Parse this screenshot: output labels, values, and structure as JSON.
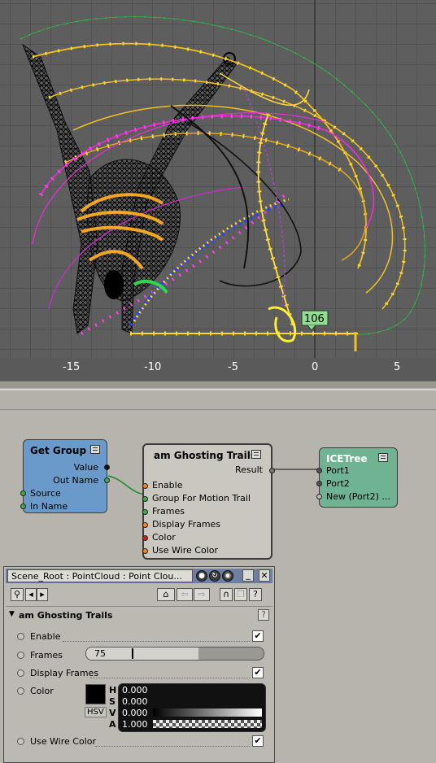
{
  "viewport": {
    "frame_label": "106",
    "ruler_ticks": [
      "-15",
      "-10",
      "-5",
      "0",
      "5"
    ]
  },
  "nodes": {
    "get_group": {
      "title": "Get Group",
      "ports": [
        "Value",
        "Out Name",
        "Source",
        "In Name"
      ],
      "color": "#6a9ac9"
    },
    "ghosting": {
      "title": "am Ghosting Trails",
      "result": "Result",
      "ports": [
        "Enable",
        "Group For Motion Trail",
        "Frames",
        "Display Frames",
        "Color",
        "Use Wire Color"
      ],
      "color": "#c9c7bf"
    },
    "icetree": {
      "title": "ICETree",
      "ports": [
        "Port1",
        "Port2",
        "New (Port2) ..."
      ],
      "color": "#6fb393"
    }
  },
  "panel": {
    "title": "Scene_Root : PointCloud : Point Clou...",
    "section": "am Ghosting Trails",
    "help": "?",
    "props": {
      "enable_label": "Enable",
      "frames_label": "Frames",
      "frames_value": "75",
      "display_frames_label": "Display Frames",
      "color_label": "Color",
      "color_mode": "HSV",
      "h_label": "H",
      "h_value": "0.000",
      "s_label": "S",
      "s_value": "0.000",
      "v_label": "V",
      "v_value": "0.000",
      "a_label": "A",
      "a_value": "1.000",
      "use_wire_color_label": "Use Wire Color"
    },
    "checks": {
      "enable": "✔",
      "display_frames": "✔",
      "use_wire_color": "✔"
    }
  }
}
